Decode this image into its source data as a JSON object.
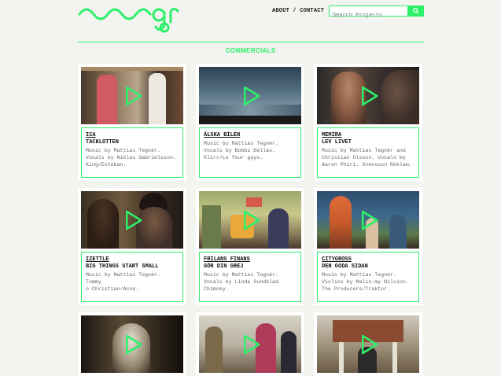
{
  "header": {
    "nav_about": "ABOUT",
    "nav_sep": "/",
    "nav_contact": "CONTACT",
    "search_placeholder": "Search Projects",
    "accent_color": "#2cf06a"
  },
  "section": {
    "title": "COMMERCIALS"
  },
  "projects": [
    {
      "client": "ICA",
      "title": "TACKLOTTEN",
      "credits": "Music by Mattias Tegnér.\nVocals by Niklas Gabrielsson.\nKing/Esteban."
    },
    {
      "client": "ÄLSKA BILEN",
      "title": "",
      "credits": "Music by Mattias Tegnér.\nVocals by Bobbi Dallas.\nKlirr/Le four guys."
    },
    {
      "client": "MEMIRA",
      "title": "LEV LIVET",
      "credits": "Music by Mattias Tegnér and\nChristian Olsson. Vocals by\nAaron Phiri. Svensson Reklam."
    },
    {
      "client": "IZETTLE",
      "title": "BIG THINGS START SMALL",
      "credits": "Music by Mattias Tegnér. Tommy\no Christian/Acne."
    },
    {
      "client": "FRILANS FINANS",
      "title": "GÖR DIN GREJ",
      "credits": "Music by Mattias Tegnér.\nVocals by Linda Sundblad.\nChimney."
    },
    {
      "client": "CITYGROSS",
      "title": "DEN GODA SIDAN",
      "credits": "Music by Mattias Tegnér.\nViolins by Malin-my Nilsson.\nThe Producers/Traktor."
    },
    {
      "client": "",
      "title": "",
      "credits": ""
    },
    {
      "client": "",
      "title": "",
      "credits": ""
    },
    {
      "client": "",
      "title": "",
      "credits": ""
    }
  ]
}
